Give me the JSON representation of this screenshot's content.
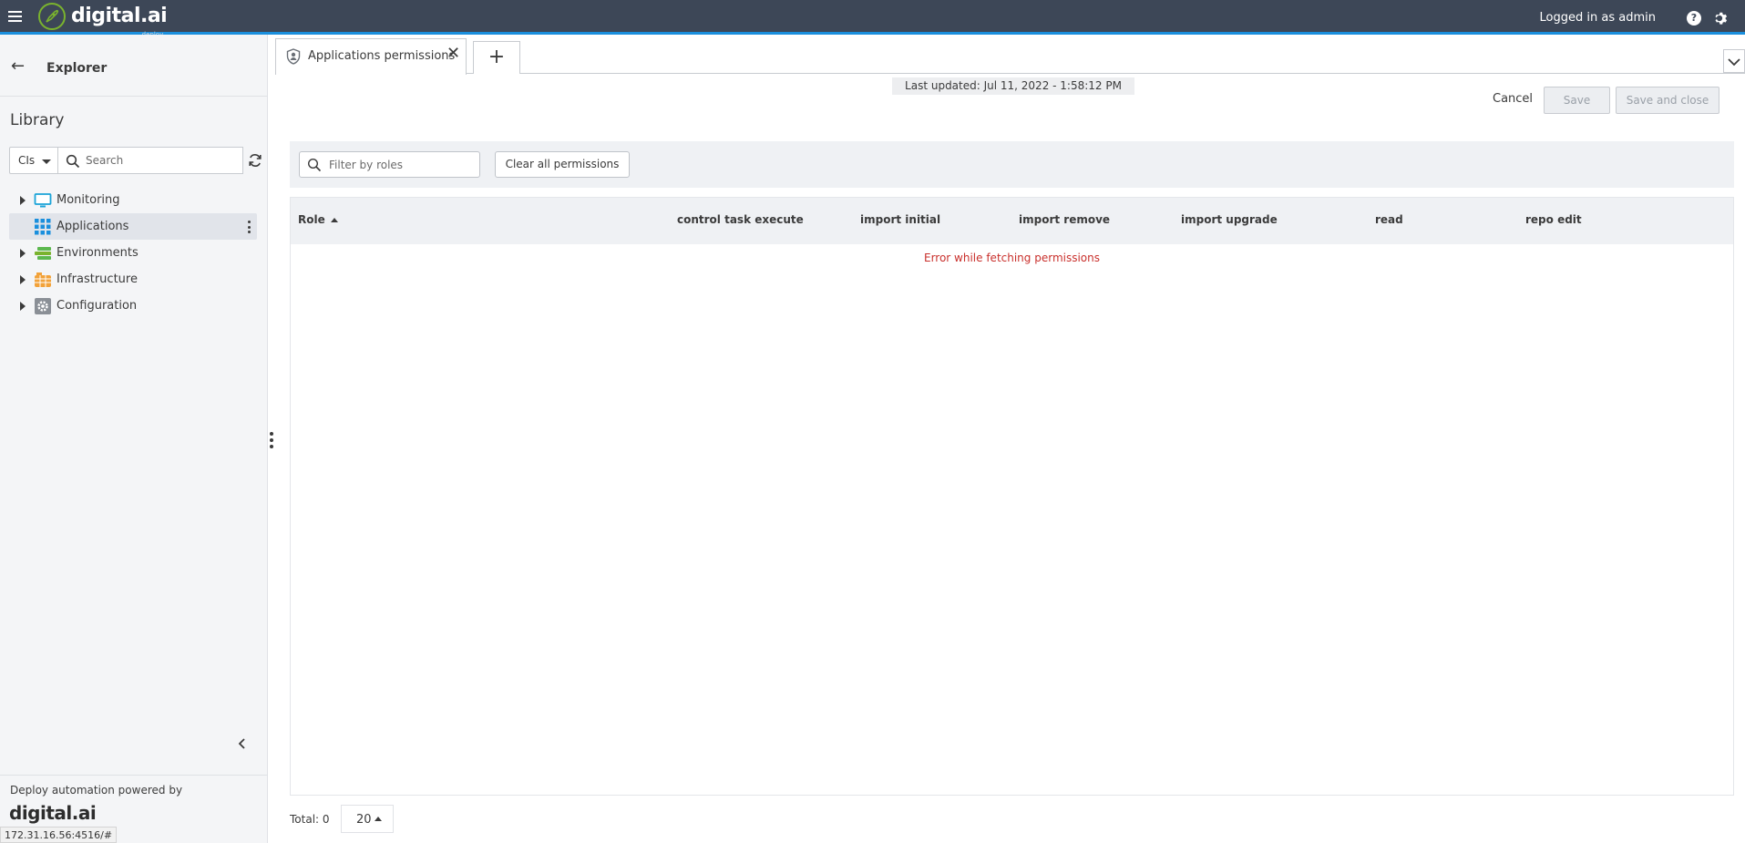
{
  "topbar": {
    "logo_text": "digital.ai",
    "logo_sub": "deploy",
    "user_text": "Logged in as admin",
    "help_icon": "help-icon",
    "settings_icon": "gear-icon",
    "bar_color": "#3d4757",
    "accent_color": "#1a8fdd"
  },
  "sidebar": {
    "title": "Explorer",
    "library_title": "Library",
    "type_select": "CIs",
    "search_placeholder": "Search",
    "items": [
      {
        "label": "Monitoring",
        "icon": "monitor-icon",
        "expandable": true
      },
      {
        "label": "Applications",
        "icon": "applications-grid-icon",
        "expandable": false,
        "selected": true
      },
      {
        "label": "Environments",
        "icon": "environments-icon",
        "expandable": true
      },
      {
        "label": "Infrastructure",
        "icon": "infrastructure-icon",
        "expandable": true
      },
      {
        "label": "Configuration",
        "icon": "configuration-gear-icon",
        "expandable": true
      }
    ],
    "powered_by": "Deploy automation powered by",
    "footer_logo": "digital.ai"
  },
  "status_url": "172.31.16.56:4516/#",
  "tabs": {
    "active_label": "Applications permissions",
    "add_label": "+"
  },
  "content": {
    "last_updated": "Last updated: Jul 11, 2022 - 1:58:12 PM",
    "cancel_label": "Cancel",
    "save_label": "Save",
    "save_close_label": "Save and close",
    "filter_placeholder": "Filter by roles",
    "clear_label": "Clear all permissions",
    "columns": [
      "Role",
      "control task execute",
      "import initial",
      "import remove",
      "import upgrade",
      "read",
      "repo edit"
    ],
    "error_message": "Error while fetching permissions",
    "total_label": "Total: 0",
    "page_size": "20",
    "error_color": "#c9302c"
  }
}
